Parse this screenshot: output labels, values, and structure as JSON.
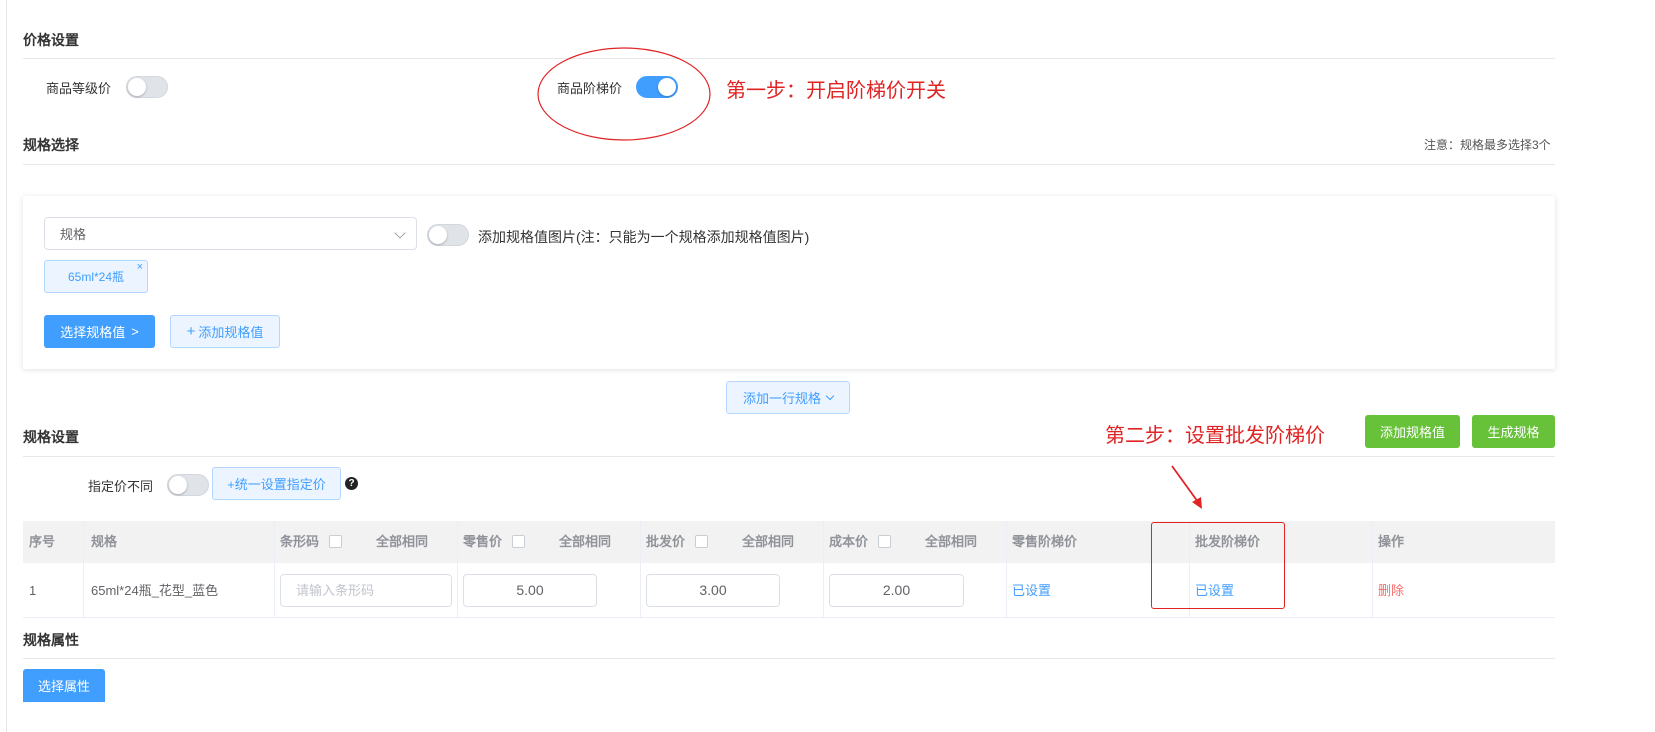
{
  "price_settings": {
    "title": "价格设置",
    "member_price_label": "商品等级价",
    "member_price_on": false,
    "tier_price_label": "商品阶梯价",
    "tier_price_on": true
  },
  "annotations": {
    "step1": "第一步：开启阶梯价开关",
    "step2": "第二步：设置批发阶梯价"
  },
  "spec_select": {
    "title": "规格选择",
    "note": "注意：规格最多选择3个",
    "select_value": "规格",
    "add_image_label": "添加规格值图片(注：只能为一个规格添加规格值图片)",
    "add_image_on": false,
    "tags": [
      "65ml*24瓶"
    ],
    "choose_values_btn": "选择规格值",
    "choose_values_icon": "chevron-right-icon",
    "add_value_btn": "添加规格值",
    "add_row_btn": "添加一行规格"
  },
  "spec_settings": {
    "title": "规格设置",
    "add_value_btn": "添加规格值",
    "generate_btn": "生成规格",
    "fixed_price_label": "指定价不同",
    "fixed_price_on": false,
    "unified_btn": "+统一设置指定价",
    "help_icon": "question-icon",
    "help_glyph": "?"
  },
  "table": {
    "headers": {
      "index": "序号",
      "spec": "规格",
      "barcode": "条形码",
      "retail": "零售价",
      "wholesale": "批发价",
      "cost": "成本价",
      "same_all": "全部相同",
      "retail_tier": "零售阶梯价",
      "wholesale_tier": "批发阶梯价",
      "action": "操作"
    },
    "rows": [
      {
        "index": "1",
        "spec": "65ml*24瓶_花型_蓝色",
        "barcode_placeholder": "请输入条形码",
        "retail": "5.00",
        "wholesale": "3.00",
        "cost": "2.00",
        "retail_tier": "已设置",
        "wholesale_tier": "已设置",
        "action": "删除"
      }
    ]
  },
  "spec_attrs": {
    "title": "规格属性",
    "choose_btn": "选择属性"
  },
  "colors": {
    "primary": "#409eff",
    "success": "#67c23a",
    "danger": "#f56c6c",
    "annotation": "#e02424"
  }
}
